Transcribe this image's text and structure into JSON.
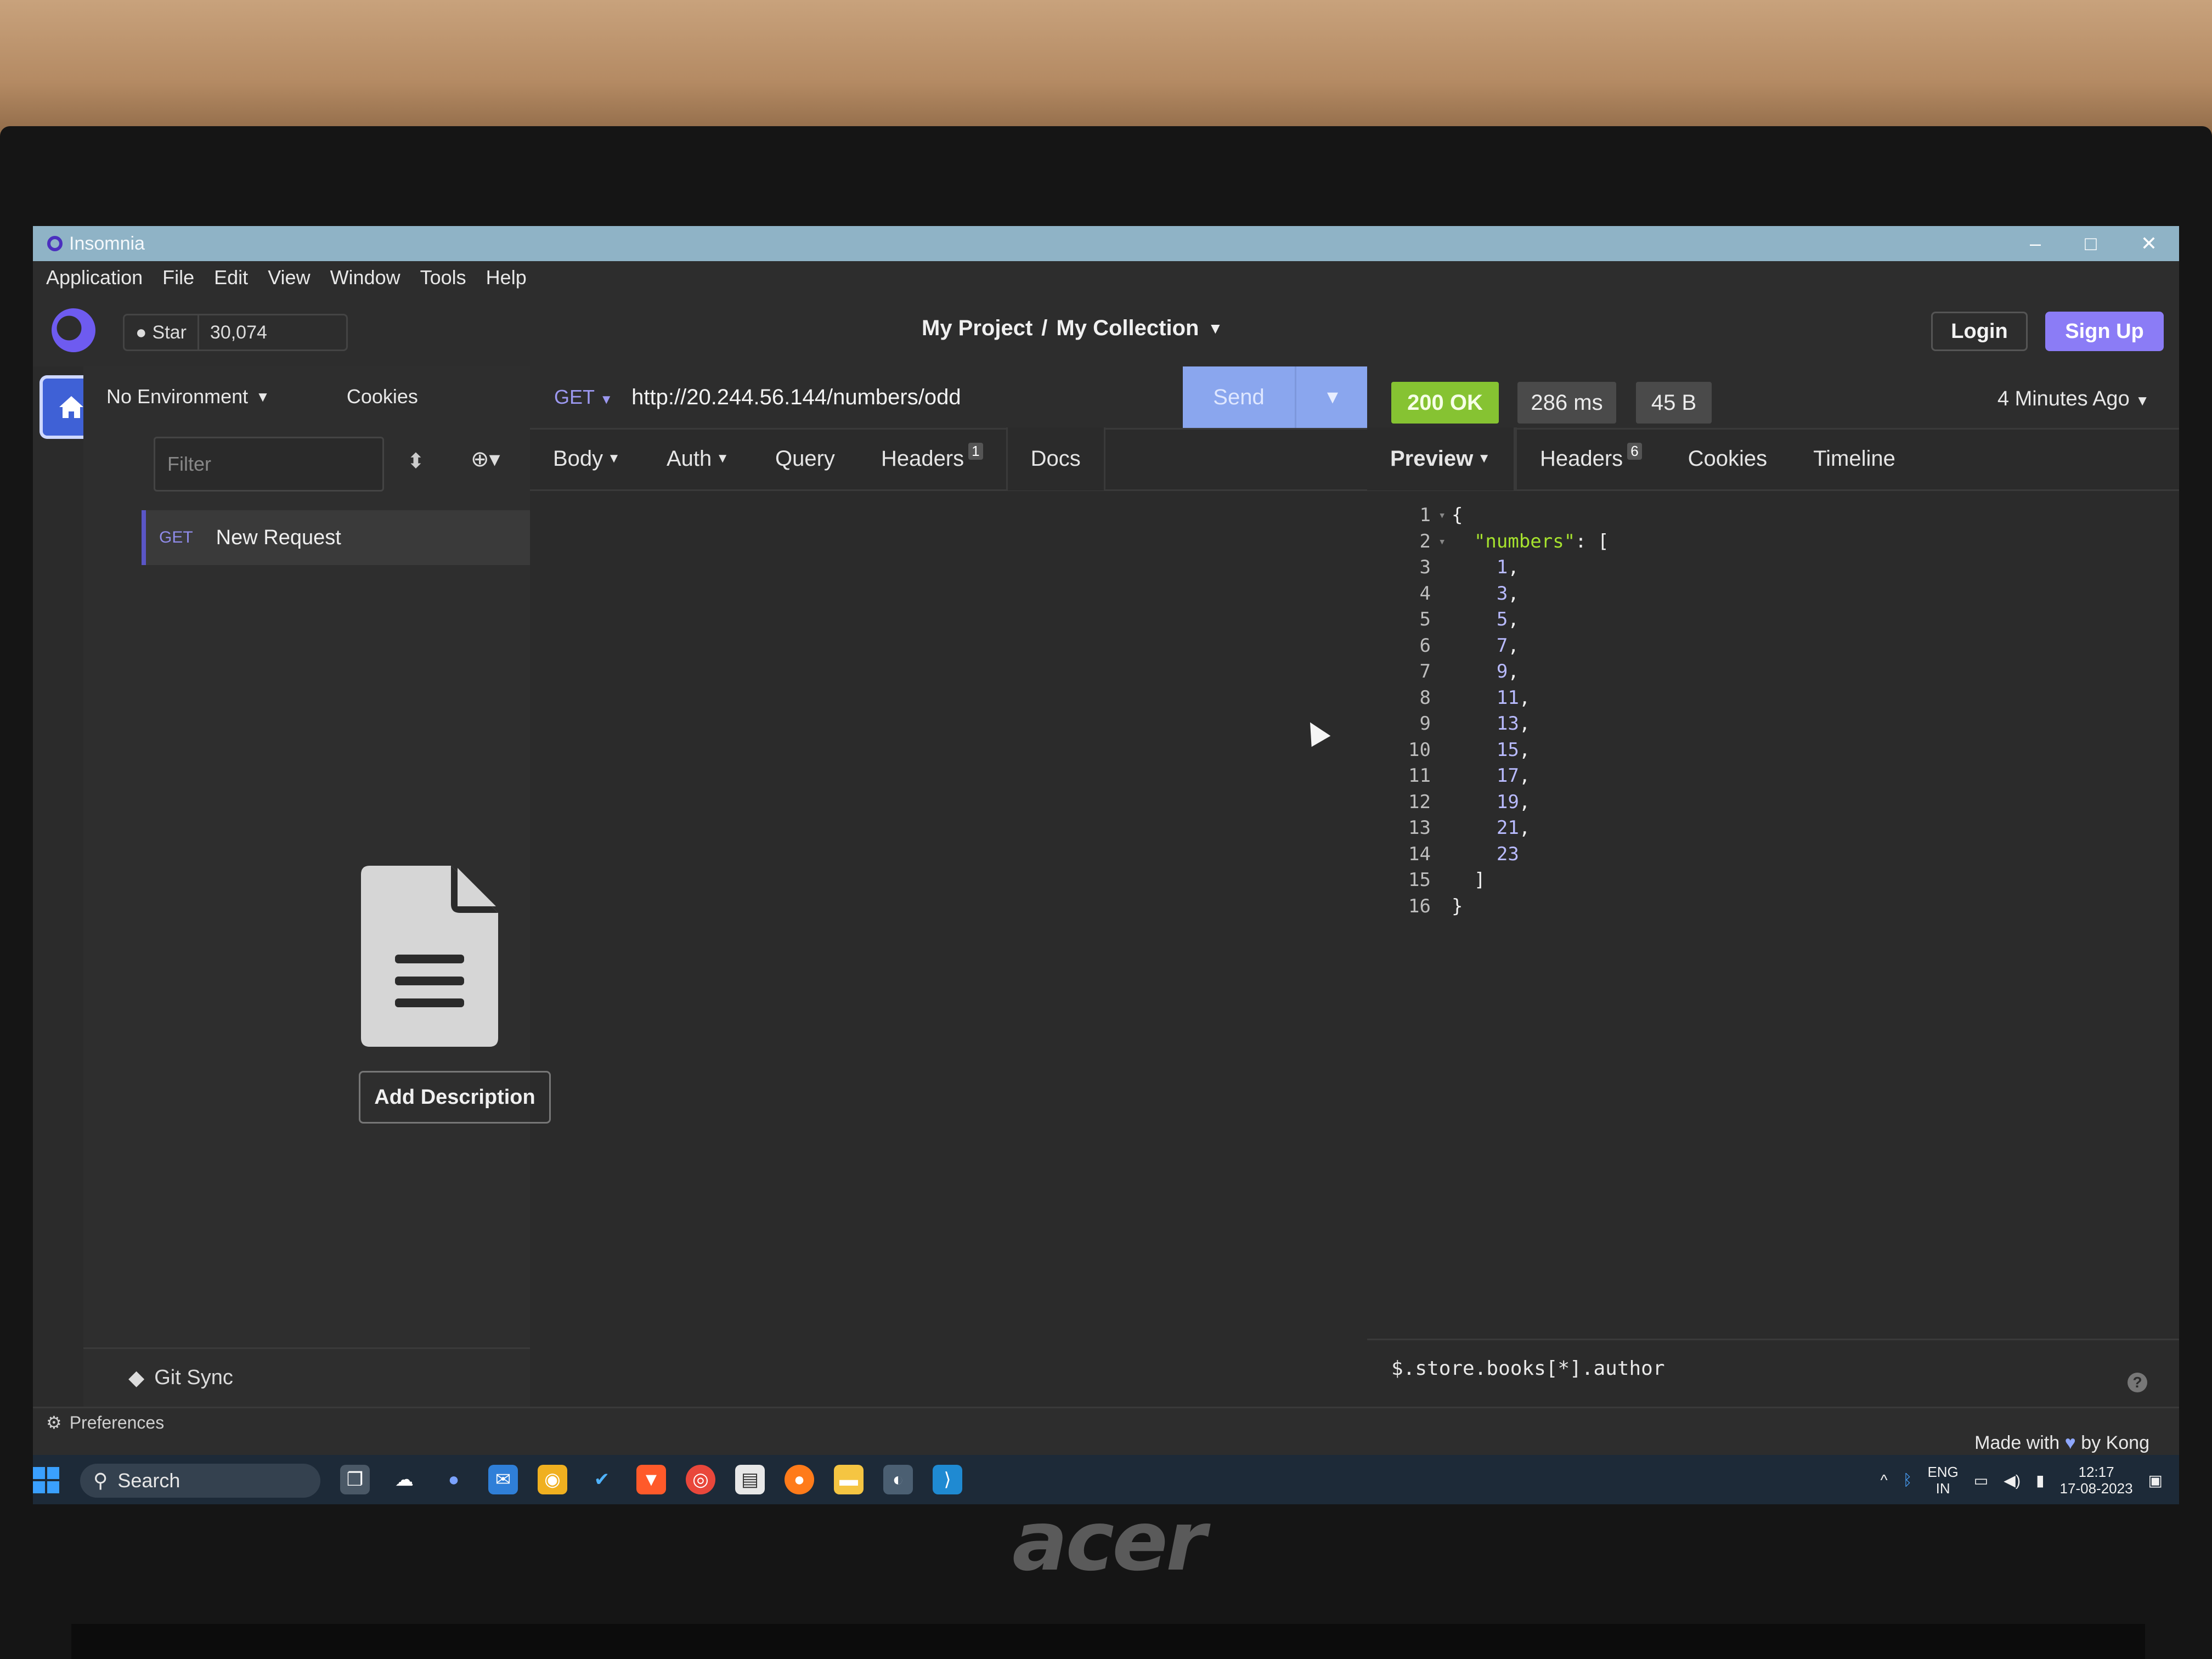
{
  "window": {
    "title": "Insomnia",
    "controls": [
      "–",
      "□",
      "✕"
    ]
  },
  "menu": [
    "Application",
    "File",
    "Edit",
    "View",
    "Window",
    "Tools",
    "Help"
  ],
  "header": {
    "star_label": "Star",
    "star_count": "30,074",
    "project": "My Project",
    "separator": "/",
    "collection": "My Collection",
    "login": "Login",
    "signup": "Sign Up"
  },
  "sidebar": {
    "environment": "No Environment",
    "cookies": "Cookies",
    "filter_placeholder": "Filter",
    "requests": [
      {
        "method": "GET",
        "name": "New Request"
      }
    ],
    "git_sync": "Git Sync"
  },
  "request": {
    "method": "GET",
    "url": "http://20.244.56.144/numbers/odd",
    "send": "Send",
    "tabs": [
      {
        "label": "Body",
        "dropdown": true
      },
      {
        "label": "Auth",
        "dropdown": true
      },
      {
        "label": "Query"
      },
      {
        "label": "Headers",
        "badge": "1"
      },
      {
        "label": "Docs",
        "active": true
      }
    ],
    "add_description": "Add Description"
  },
  "response": {
    "status": "200 OK",
    "time": "286 ms",
    "size": "45 B",
    "ago": "4 Minutes Ago",
    "tabs": [
      {
        "label": "Preview",
        "dropdown": true,
        "active": true
      },
      {
        "label": "Headers",
        "badge": "6"
      },
      {
        "label": "Cookies"
      },
      {
        "label": "Timeline"
      }
    ],
    "body_lines": [
      {
        "n": "1",
        "fold": "▾",
        "t": "{"
      },
      {
        "n": "2",
        "fold": "▾",
        "key": "\"numbers\"",
        "t": ": ["
      },
      {
        "n": "3",
        "val": "1",
        "t": ","
      },
      {
        "n": "4",
        "val": "3",
        "t": ","
      },
      {
        "n": "5",
        "val": "5",
        "t": ","
      },
      {
        "n": "6",
        "val": "7",
        "t": ","
      },
      {
        "n": "7",
        "val": "9",
        "t": ","
      },
      {
        "n": "8",
        "val": "11",
        "t": ","
      },
      {
        "n": "9",
        "val": "13",
        "t": ","
      },
      {
        "n": "10",
        "val": "15",
        "t": ","
      },
      {
        "n": "11",
        "val": "17",
        "t": ","
      },
      {
        "n": "12",
        "val": "19",
        "t": ","
      },
      {
        "n": "13",
        "val": "21",
        "t": ","
      },
      {
        "n": "14",
        "val": "23",
        "t": ""
      },
      {
        "n": "15",
        "t": "  ]"
      },
      {
        "n": "16",
        "t": "}"
      }
    ],
    "filter_query": "$.store.books[*].author"
  },
  "footer": {
    "preferences": "Preferences",
    "made_with": "Made with",
    "by": "by Kong"
  },
  "taskbar": {
    "search": "Search",
    "lang": "ENG",
    "region": "IN",
    "time": "12:17",
    "date": "17-08-2023"
  },
  "laptop_brand": "acer",
  "colors": {
    "accent": "#8b7cf6",
    "status_ok": "#86c332",
    "send": "#8aa6ee",
    "json_key": "#a6e22e",
    "json_value": "#b9bbff"
  }
}
